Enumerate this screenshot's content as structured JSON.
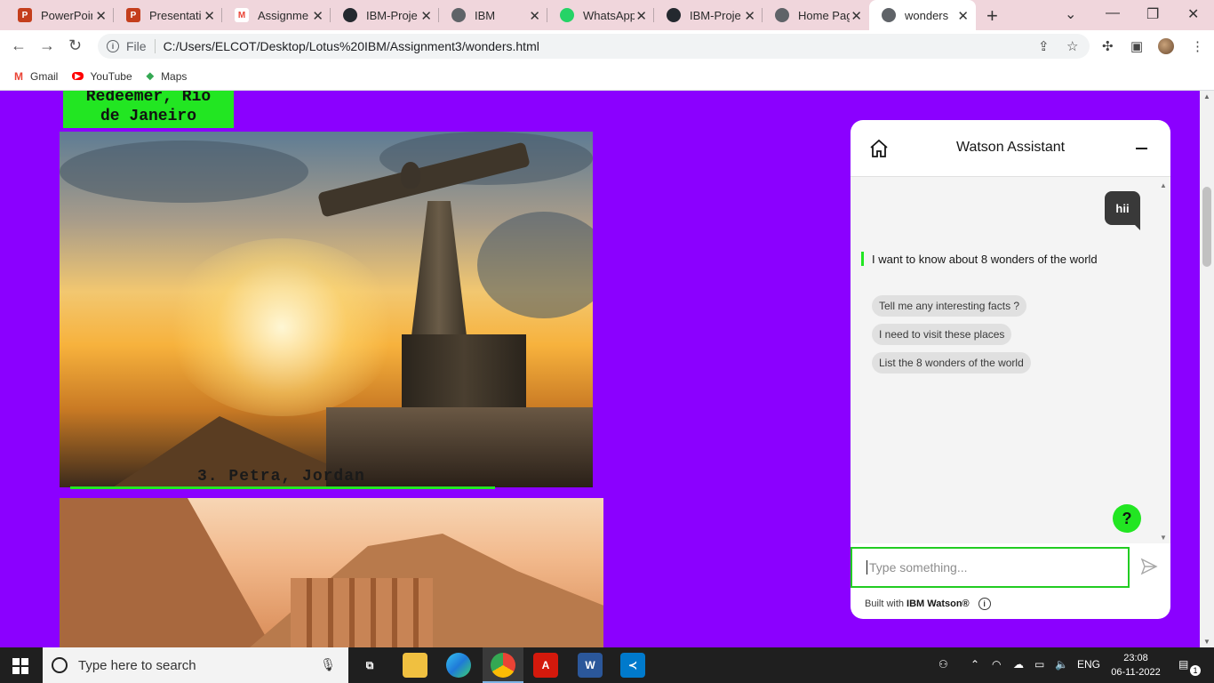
{
  "browser": {
    "tabs": [
      {
        "title": "PowerPoin",
        "favicon": "powerpoint-icon",
        "color": "#c43e1c",
        "glyph": "P"
      },
      {
        "title": "Presentatio",
        "favicon": "powerpoint-icon",
        "color": "#c43e1c",
        "glyph": "P"
      },
      {
        "title": "Assignmen",
        "favicon": "gmail-icon",
        "color": "#ea4335",
        "glyph": "M"
      },
      {
        "title": "IBM-Proje",
        "favicon": "github-icon",
        "color": "#24292f",
        "glyph": "●"
      },
      {
        "title": "IBM",
        "favicon": "globe-icon",
        "color": "#5f6368",
        "glyph": "◍"
      },
      {
        "title": "WhatsApp",
        "favicon": "whatsapp-icon",
        "color": "#25d366",
        "glyph": "✆"
      },
      {
        "title": "IBM-Proje",
        "favicon": "github-icon",
        "color": "#24292f",
        "glyph": "●"
      },
      {
        "title": "Home Pag",
        "favicon": "globe-icon",
        "color": "#5f6368",
        "glyph": "◍"
      },
      {
        "title": "wonders",
        "favicon": "globe-icon",
        "color": "#5f6368",
        "glyph": "◍",
        "active": true
      }
    ],
    "address": {
      "scheme_label": "File",
      "url": "C:/Users/ELCOT/Desktop/Lotus%20IBM/Assignment3/wonders.html"
    },
    "bookmarks": [
      {
        "label": "Gmail",
        "icon": "gmail-icon",
        "color": "#ea4335",
        "glyph": "M"
      },
      {
        "label": "YouTube",
        "icon": "youtube-icon",
        "color": "#ff0000",
        "glyph": "▶"
      },
      {
        "label": "Maps",
        "icon": "maps-icon",
        "color": "#34a853",
        "glyph": "⬥"
      }
    ]
  },
  "page": {
    "redeemer_label_line1": "Redeemer, Rio",
    "redeemer_label_line2": "de Janeiro",
    "petra_caption": "3. Petra, Jordan",
    "background_color": "#8b00ff",
    "accent_color": "#22e622"
  },
  "watson": {
    "title": "Watson Assistant",
    "user_message": "hii",
    "bot_message": "I want to know about 8 wonders of the world",
    "options": [
      "Tell me any interesting facts ?",
      "I need to visit these places",
      "List the 8 wonders of the world"
    ],
    "help_glyph": "?",
    "input_placeholder": "Type something...",
    "footer_prefix": "Built with",
    "footer_brand": "IBM Watson®"
  },
  "taskbar": {
    "search_placeholder": "Type here to search",
    "language": "ENG",
    "time": "23:08",
    "date": "06-11-2022",
    "notification_count": "1"
  }
}
